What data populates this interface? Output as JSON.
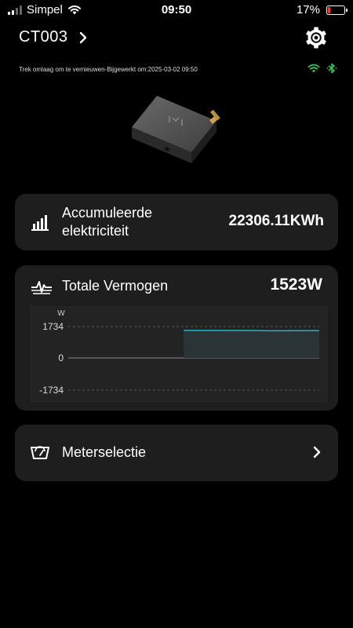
{
  "status_bar": {
    "carrier": "Simpel",
    "time": "09:50",
    "battery": "17%",
    "battery_level": 0.17
  },
  "header": {
    "device_name": "CT003"
  },
  "refresh_text": "Trek omlaag om te vernieuwen-Bijgewerkt om:2025-03-02 09:50",
  "connectivity": {
    "wifi_color": "#34c759",
    "bluetooth_color": "#34c759"
  },
  "energy_card": {
    "label_line1": "Accumuleerde",
    "label_line2": "elektriciteit",
    "value": "22306.11KWh"
  },
  "power_card": {
    "label": "Totale Vermogen",
    "value": "1523W"
  },
  "chart_data": {
    "type": "area",
    "ylabel": "W",
    "ylim": [
      -1734,
      1734
    ],
    "y_ticks": [
      "1734",
      "0",
      "-1734"
    ],
    "series": [
      {
        "color": "#2ab3c0",
        "x": [
          0.46,
          0.6,
          0.74,
          0.8,
          0.9,
          1.0
        ],
        "values": [
          1523,
          1525,
          1515,
          1500,
          1505,
          1510
        ]
      }
    ]
  },
  "meter_card": {
    "label": "Meterselectie"
  }
}
